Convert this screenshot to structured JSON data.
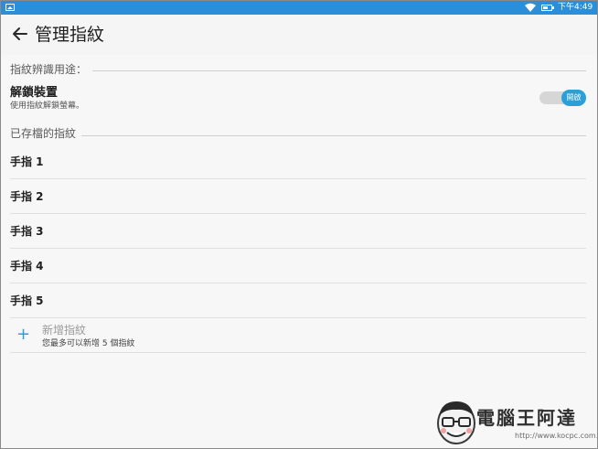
{
  "status_bar": {
    "time": "下午4:49",
    "icons": [
      "image-icon",
      "wifi-icon",
      "battery-icon"
    ]
  },
  "app_bar": {
    "title": "管理指紋",
    "back_icon": "arrow-back-icon"
  },
  "sections": {
    "usage_header": "指紋辨識用途：",
    "saved_header": "已存檔的指紋"
  },
  "unlock_pref": {
    "title": "解鎖裝置",
    "subtitle": "使用指紋解鎖螢幕。",
    "toggle_label": "開啟",
    "toggle_on": true
  },
  "fingerprints": [
    {
      "label": "手指 1"
    },
    {
      "label": "手指 2"
    },
    {
      "label": "手指 3"
    },
    {
      "label": "手指 4"
    },
    {
      "label": "手指 5"
    }
  ],
  "add_fingerprint": {
    "title": "新增指紋",
    "subtitle": "您最多可以新增 5 個指紋",
    "icon": "plus-icon"
  },
  "watermark": {
    "title": "電腦王阿達",
    "url": "http://www.kocpc.com.tw"
  },
  "colors": {
    "status_bar": "#2a8fd8",
    "accent": "#2a9fd8",
    "background": "#f7f7f7"
  }
}
